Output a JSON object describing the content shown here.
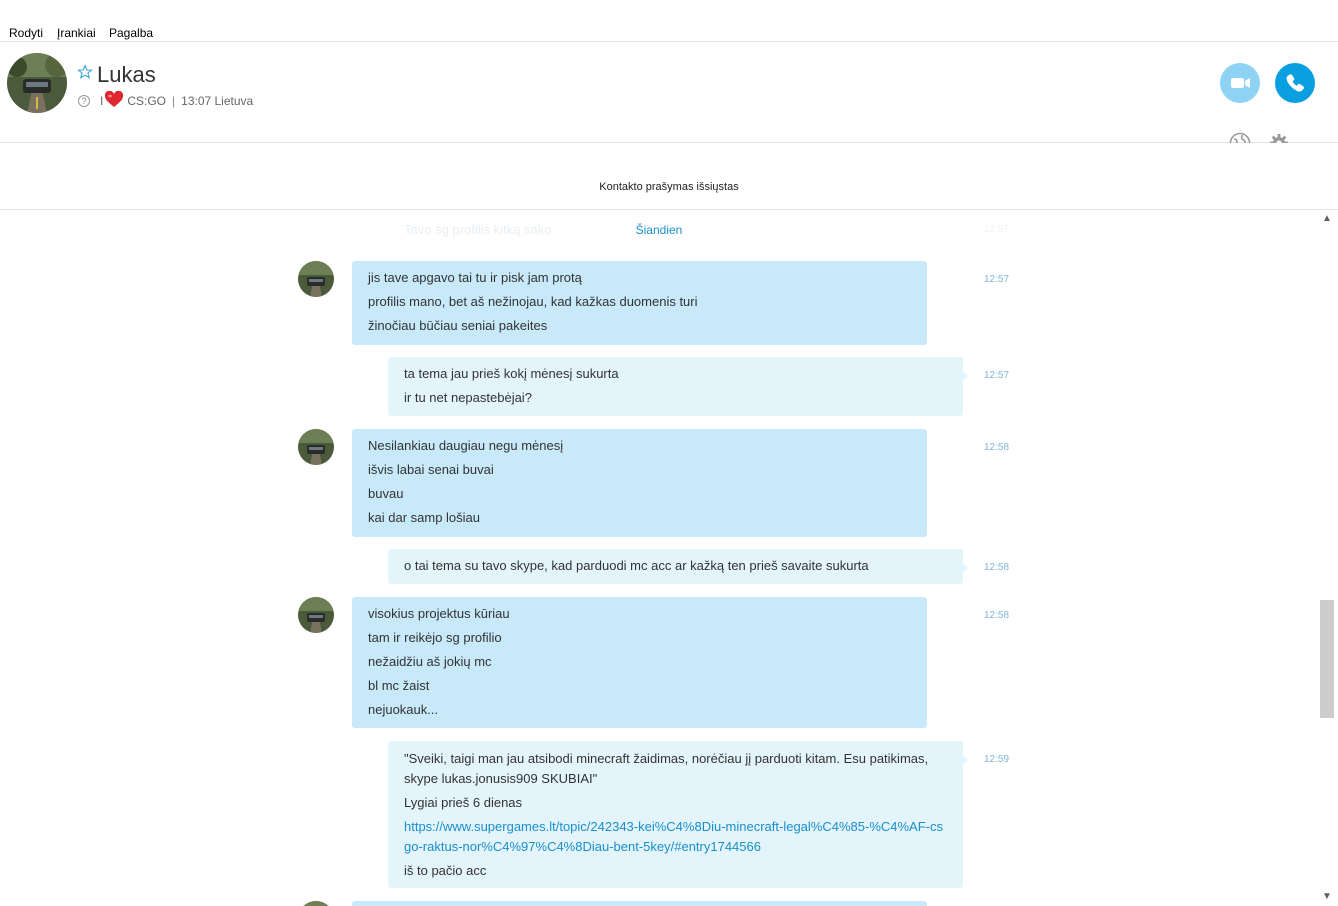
{
  "menu": {
    "items": [
      "Rodyti",
      "Įrankiai",
      "Pagalba"
    ]
  },
  "header": {
    "name": "Lukas",
    "mood_prefix": "I",
    "mood_text": "CS:GO",
    "local_time": "13:07 Lietuva",
    "icons": {
      "favorite": "star-icon",
      "status": "question-icon",
      "video": "video-camera-icon",
      "call": "phone-icon",
      "share": "globe-icon",
      "settings": "gear-icon"
    }
  },
  "notice": "Kontakto prašymas išsiųstas",
  "chat": {
    "ghost_text": "Tavo sg profilis kitką sako",
    "ghost_time": "12:57",
    "day_label": "Šiandien",
    "messages": [
      {
        "from": "contact",
        "time": "12:57",
        "lines": [
          "jis tave apgavo tai tu ir pisk jam protą",
          "profilis mano, bet aš nežinojau, kad kažkas duomenis turi",
          "žinočiau būčiau seniai pakeites"
        ]
      },
      {
        "from": "me",
        "time": "12:57",
        "lines": [
          "ta tema jau prieš kokį mėnesį sukurta",
          "ir tu net nepastebėjai?"
        ]
      },
      {
        "from": "contact",
        "time": "12:58",
        "lines": [
          "Nesilankiau daugiau negu mėnesį",
          "išvis labai senai buvai",
          "buvau",
          "kai dar samp lošiau"
        ]
      },
      {
        "from": "me",
        "time": "12:58",
        "lines": [
          "o tai tema su tavo skype, kad parduodi mc acc ar kažką ten prieš savaite sukurta"
        ]
      },
      {
        "from": "contact",
        "time": "12:58",
        "lines": [
          "visokius projektus kūriau",
          "tam ir reikėjo sg profilio",
          "nežaidžiu aš jokių mc",
          "bl mc žaist",
          "nejuokauk..."
        ]
      },
      {
        "from": "me",
        "time": "12:59",
        "quote": "\"Sveiki, taigi man jau atsibodi minecraft žaidimas, norėčiau jį parduoti kitam. Esu patikimas, skype lukas.jonusis909 SKUBIAI\"",
        "line2": "Lygiai prieš 6 dienas",
        "link": "https://www.supergames.lt/topic/242343-kei%C4%8Diu-minecraft-legal%C4%85-%C4%AF-csgo-raktus-nor%C4%97%C4%8Diau-bent-5key/#entry1744566",
        "line4": "iš to pačio acc"
      }
    ]
  },
  "colors": {
    "incoming": "#c7e9f9",
    "outgoing": "#e3f4fb",
    "accent": "#0a9fe1",
    "time": "#7fb7d6"
  }
}
